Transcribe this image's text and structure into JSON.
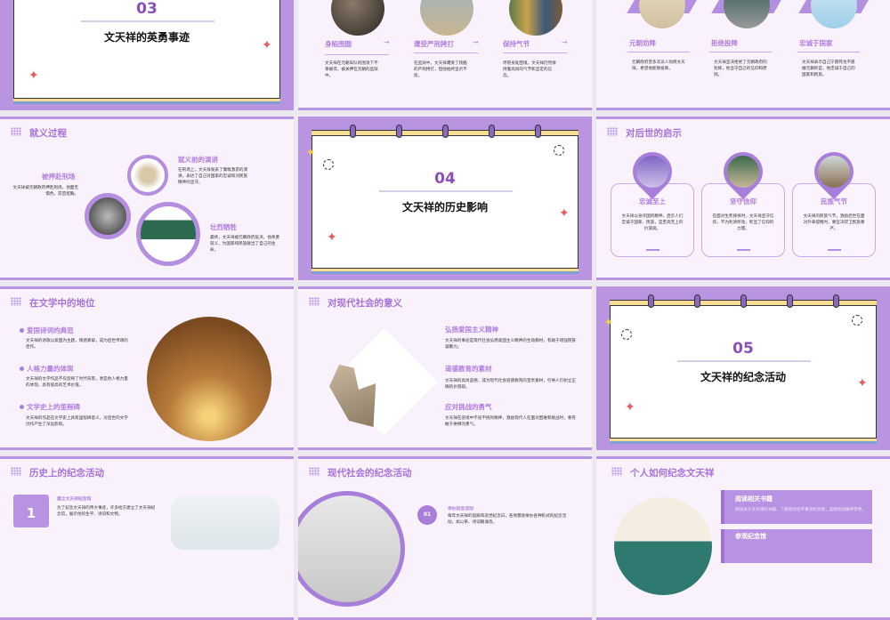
{
  "slides": {
    "heroic": {
      "number": "03",
      "title": "文天祥的英勇事迹"
    },
    "deeds": {
      "items": [
        {
          "label": "身陷囹圄",
          "text": "文天祥在元朝军队的围攻下不幸被俘，被关押在元朝的监狱中。"
        },
        {
          "label": "遭受严刑拷打",
          "text": "在监狱中，文天祥遭受了残酷的严刑拷打，但他始终坚贞不屈。"
        },
        {
          "label": "保持气节",
          "text": "尽管身处困境，文天祥仍然保持着高尚的气节和坚定的信念。"
        }
      ]
    },
    "surrender": {
      "items": [
        {
          "label": "元朝劝降",
          "text": "元朝政府曾多次派人劝降文天祥，希望他能够投降。"
        },
        {
          "label": "拒绝投降",
          "text": "文天祥坚决拒绝了元朝政府的劝降，他坚守自己的信仰和原则。"
        },
        {
          "label": "忠诚于国家",
          "text": "文天祥表示自己宁愿死也不愿做元朝的官，他忠诚于自己的国家和民族。"
        }
      ]
    },
    "execution": {
      "title": "就义过程",
      "items": [
        {
          "label": "被押赴刑场",
          "text": "文天祥被元朝政府押赴刑场，他面无惧色，昂首挺胸。"
        },
        {
          "label": "就义前的演讲",
          "text": "在刑场上，文天祥发表了慷慨激昂的演讲，表达了自己对国家的忠诚和对民族精神的坚守。"
        },
        {
          "label": "壮烈牺牲",
          "text": "最终，文天祥被元朝政府处决，他英勇就义，为国家和民族献出了自己的生命。"
        }
      ]
    },
    "influence": {
      "number": "04",
      "title": "文天祥的历史影响"
    },
    "inspiration": {
      "title": "对后世的启示",
      "items": [
        {
          "label": "忠诚至上",
          "text": "文天祥以身许国的精神，启示人们忠诚于国家、民族，是至高无上的价值观。"
        },
        {
          "label": "坚守信仰",
          "text": "在面对生死抉择时，文天祥坚守信仰，不为利诱所动，彰显了信仰的力量。"
        },
        {
          "label": "民族气节",
          "text": "文天祥的民族气节，激励后世在面对外来侵略时，要坚决捍卫民族尊严。"
        }
      ]
    },
    "literature": {
      "title": "在文学中的地位",
      "items": [
        {
          "label": "爱国诗词的典范",
          "text": "文天祥的诗歌以爱国为主题，情感真挚，成为后世传颂的佳作。"
        },
        {
          "label": "人格力量的体现",
          "text": "文天祥的文学作品不仅反映了时代背景，更是他人格力量的体现，具有极高的艺术价值。"
        },
        {
          "label": "文学史上的里程碑",
          "text": "文天祥的作品在文学史上具有里程碑意义，对后世的文学创作产生了深远影响。"
        }
      ]
    },
    "modern": {
      "title": "对现代社会的意义",
      "items": [
        {
          "label": "弘扬爱国主义精神",
          "text": "文天祥的事迹是现代社会弘扬爱国主义精神的生动教材，有助于增强民族凝聚力。"
        },
        {
          "label": "道德教育的素材",
          "text": "文天祥的高尚品德，成为现代社会道德教育的宝贵素材，引导人们树立正确的价值观。"
        },
        {
          "label": "应对挑战的勇气",
          "text": "文天祥在逆境中不屈不挠的精神，激励现代人在面对困难和挑战时，要有敢于拼搏的勇气。"
        }
      ]
    },
    "memorial": {
      "number": "05",
      "title": "文天祥的纪念活动"
    },
    "historic_events": {
      "title": "历史上的纪念活动",
      "items": [
        {
          "index": "1",
          "label": "建立文天祥纪念馆",
          "text": "为了纪念文天祥的伟大事迹，许多地方建立了文天祥纪念馆，展示他的生平、诗词和文物。"
        }
      ]
    },
    "modern_events": {
      "title": "现代社会的纪念活动",
      "items": [
        {
          "index": "01",
          "label": "举办纪念活动",
          "text": "每年文天祥的诞辰和逝世纪念日，各地都会举办各种形式的纪念活动，如公祭、诗词朗诵等。"
        }
      ]
    },
    "personal": {
      "title": "个人如何纪念文天祥",
      "items": [
        {
          "label": "阅读相关书籍",
          "text": "阅读关于文天祥的书籍，了解他的生平事迹和思想，汲取他的精神营养。"
        },
        {
          "label": "参观纪念馆",
          "text": ""
        }
      ]
    }
  }
}
